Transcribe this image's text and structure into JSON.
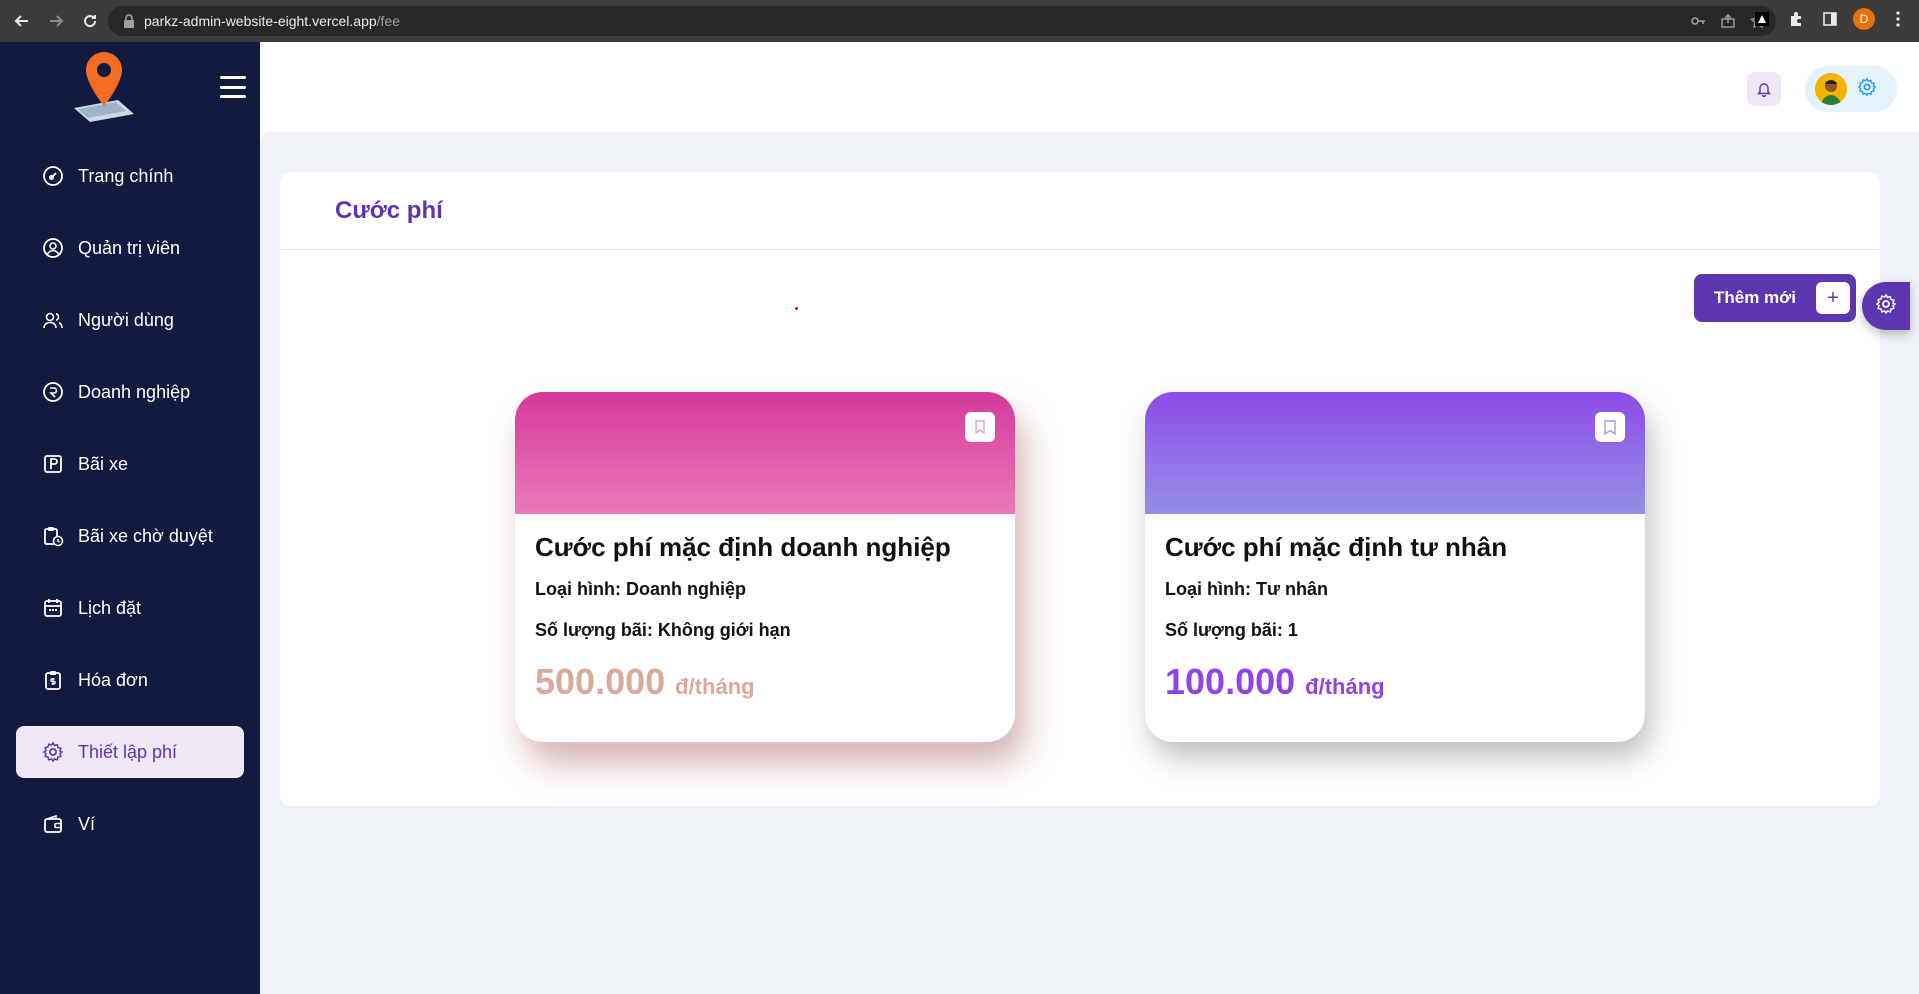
{
  "browser": {
    "url_host": "parkz-admin-website-eight.vercel.app",
    "url_path": "/fee",
    "profile_initial": "D"
  },
  "sidebar": {
    "items": [
      {
        "label": "Trang chính",
        "icon": "dashboard-icon"
      },
      {
        "label": "Quản trị viên",
        "icon": "admin-user-icon"
      },
      {
        "label": "Người dùng",
        "icon": "users-icon"
      },
      {
        "label": "Doanh nghiệp",
        "icon": "business-icon"
      },
      {
        "label": "Bãi xe",
        "icon": "parking-icon"
      },
      {
        "label": "Bãi xe chờ duyệt",
        "icon": "clipboard-clock-icon"
      },
      {
        "label": "Lịch đặt",
        "icon": "calendar-icon"
      },
      {
        "label": "Hóa đơn",
        "icon": "invoice-icon"
      },
      {
        "label": "Thiết lập phí",
        "icon": "gear-icon",
        "active": true
      },
      {
        "label": "Ví",
        "icon": "wallet-icon"
      }
    ]
  },
  "page": {
    "title": "Cước phí",
    "add_button": "Thêm mới"
  },
  "fees": [
    {
      "name": "Cước phí mặc định doanh nghiệp",
      "type_line": "Loại hình: Doanh nghiệp",
      "count_line": "Số lượng bãi: Không giới hạn",
      "price": "500.000",
      "unit": "đ/tháng"
    },
    {
      "name": "Cước phí mặc định tư nhân",
      "type_line": "Loại hình: Tư nhân",
      "count_line": "Số lượng bãi: 1",
      "price": "100.000",
      "unit": "đ/tháng"
    }
  ],
  "colors": {
    "sidebar_bg": "#131a40",
    "accent": "#5e35b1",
    "card1_gradient": "#d6399a",
    "card2_gradient": "#8e4ae8"
  }
}
